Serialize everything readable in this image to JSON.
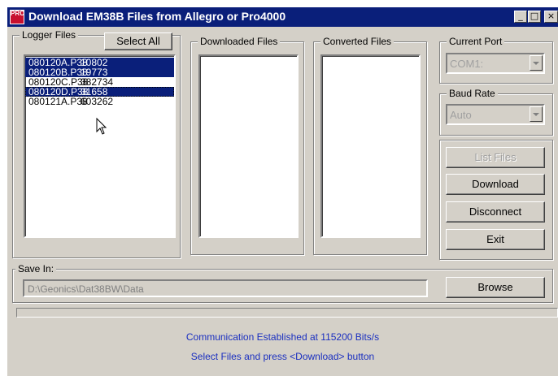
{
  "window": {
    "title": "Download EM38B Files from Allegro or Pro4000",
    "icon_text": "PRO",
    "controls": {
      "minimize": "_",
      "maximize": "□",
      "close": "×"
    }
  },
  "logger_files": {
    "label": "Logger Files",
    "select_all_label": "Select All",
    "items": [
      {
        "name": "080120A.P38",
        "size": "10802",
        "selected": true
      },
      {
        "name": "080120B.P38",
        "size": "19773",
        "selected": true
      },
      {
        "name": "080120C.P38",
        "size": "382734",
        "selected": false
      },
      {
        "name": "080120D.P38",
        "size": "31658",
        "selected": true
      },
      {
        "name": "080121A.P38",
        "size": "603262",
        "selected": false
      }
    ]
  },
  "downloaded_files": {
    "label": "Downloaded Files"
  },
  "converted_files": {
    "label": "Converted Files"
  },
  "current_port": {
    "label": "Current Port",
    "value": "COM1:"
  },
  "baud_rate": {
    "label": "Baud Rate",
    "value": "Auto"
  },
  "actions": {
    "list_files": "List Files",
    "download": "Download",
    "disconnect": "Disconnect",
    "exit": "Exit"
  },
  "save_in": {
    "label": "Save In:",
    "path": "D:\\Geonics\\Dat38BW\\Data",
    "browse_label": "Browse"
  },
  "progress": 0,
  "status": {
    "line1": "Communication Established at 115200 Bits/s",
    "line2": "Select Files and press <Download> button"
  }
}
